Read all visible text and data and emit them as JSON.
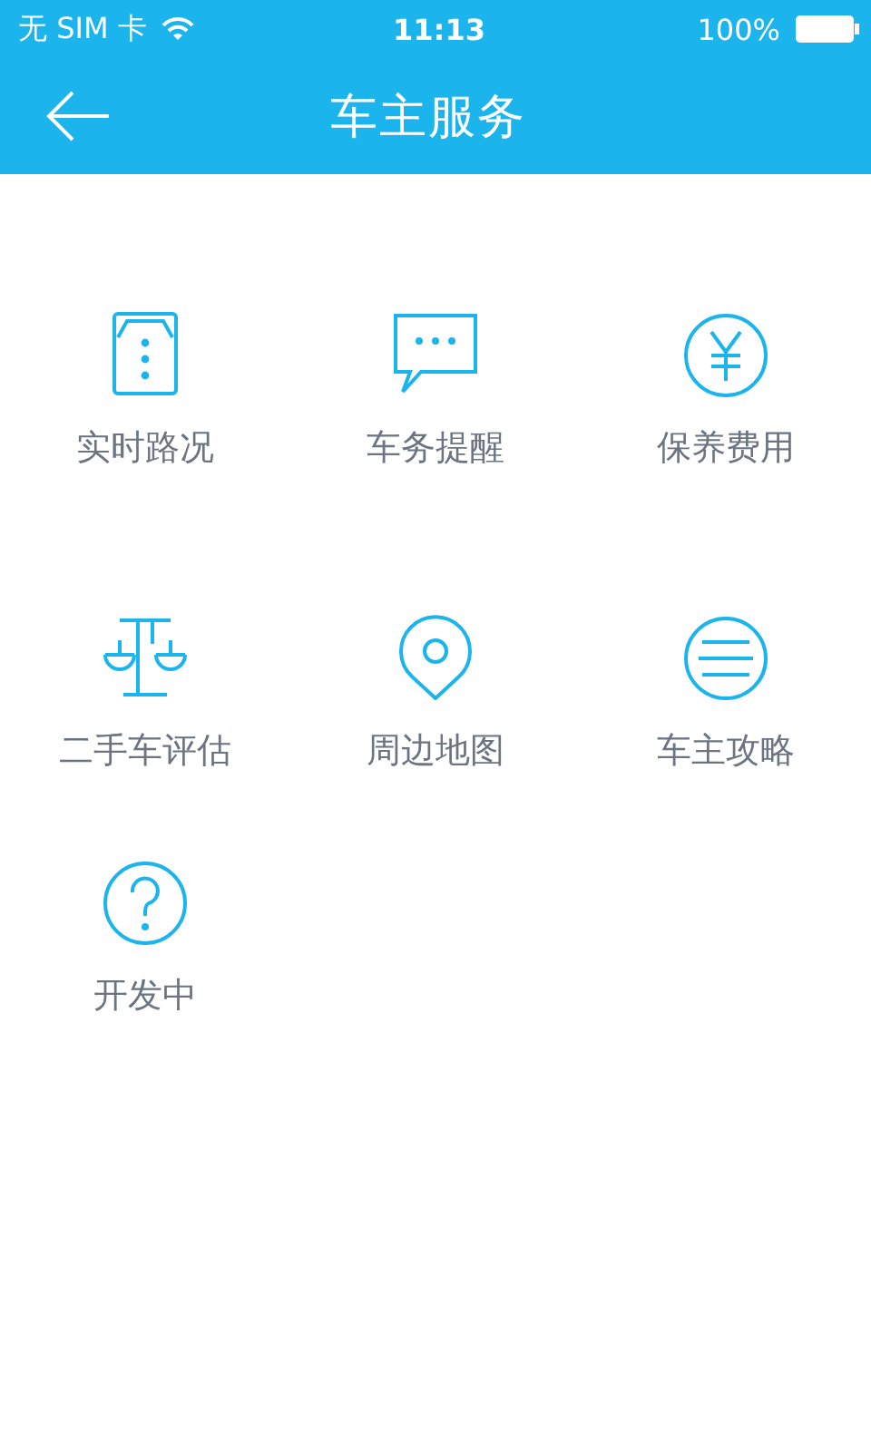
{
  "status_bar": {
    "carrier": "无 SIM 卡",
    "time": "11:13",
    "battery": "100%"
  },
  "header": {
    "title": "车主服务"
  },
  "services": [
    {
      "kind": "traffic",
      "label": "实时路况"
    },
    {
      "kind": "chat",
      "label": "车务提醒"
    },
    {
      "kind": "yen",
      "label": "保养费用"
    },
    {
      "kind": "scale",
      "label": "二手车评估"
    },
    {
      "kind": "pin",
      "label": "周边地图"
    },
    {
      "kind": "list",
      "label": "车主攻略"
    },
    {
      "kind": "question",
      "label": "开发中"
    }
  ]
}
